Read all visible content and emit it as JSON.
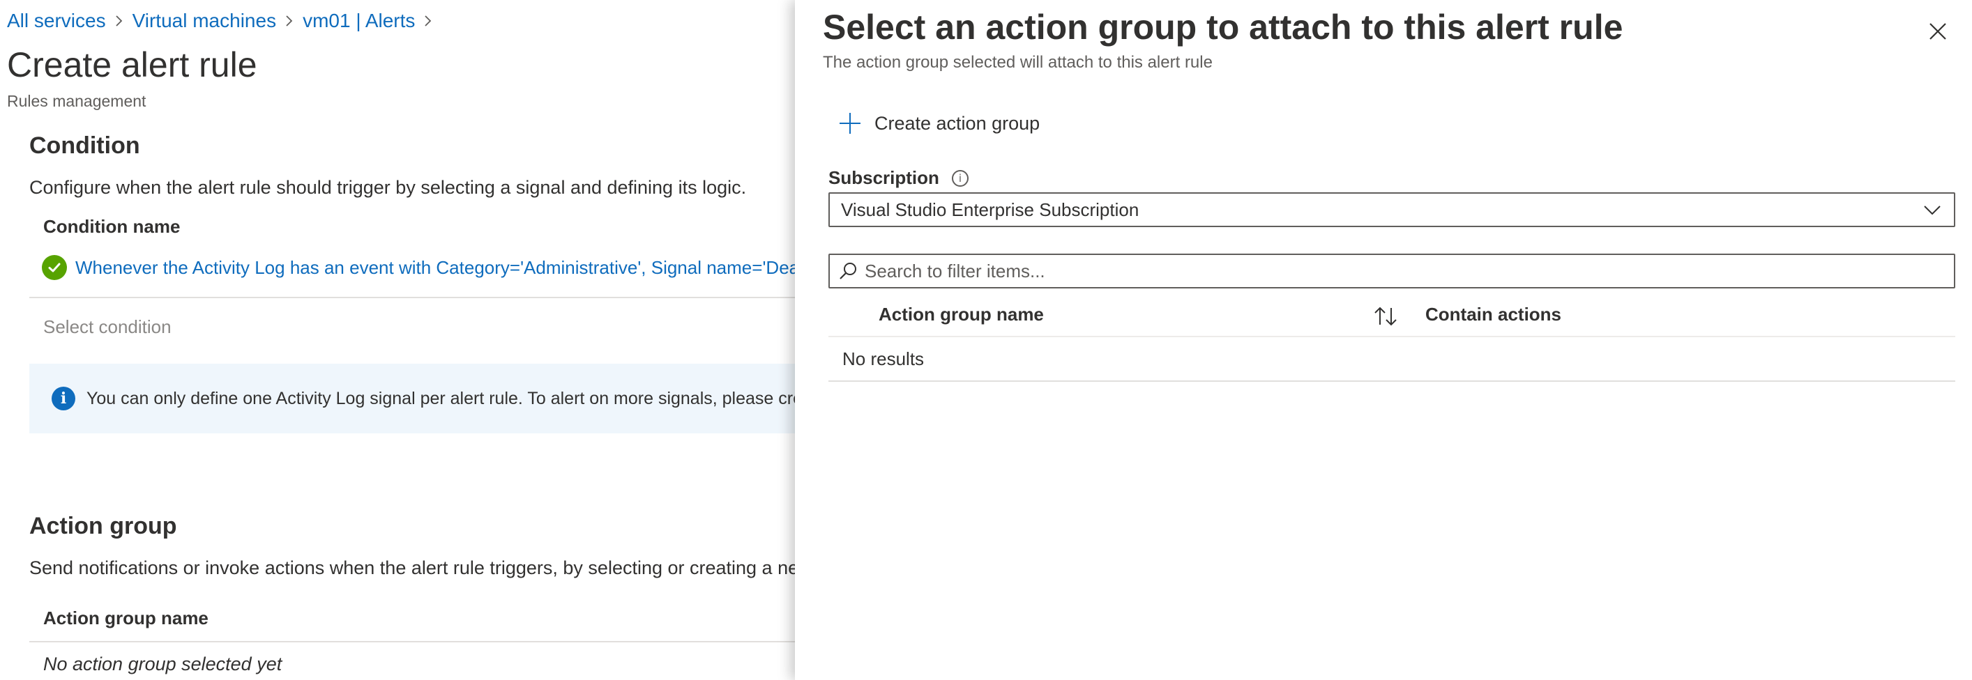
{
  "breadcrumb": {
    "items": [
      "All services",
      "Virtual machines",
      "vm01 | Alerts"
    ]
  },
  "page": {
    "title": "Create alert rule",
    "subtitle": "Rules management"
  },
  "condition": {
    "title": "Condition",
    "description": "Configure when the alert rule should trigger by selecting a signal and defining its logic.",
    "column_header": "Condition name",
    "condition_link": "Whenever the Activity Log has an event with Category='Administrative', Signal name='Dea",
    "select_condition": "Select condition",
    "info_text": "You can only define one Activity Log signal per alert rule. To alert on more signals, please create"
  },
  "action_group": {
    "title": "Action group",
    "description": "Send notifications or invoke actions when the alert rule triggers, by selecting or creating a new a",
    "column_header": "Action group name",
    "empty_text": "No action group selected yet"
  },
  "pane": {
    "title": "Select an action group to attach to this alert rule",
    "subtitle": "The action group selected will attach to this alert rule",
    "create_label": "Create action group",
    "subscription_label": "Subscription",
    "subscription_value": "Visual Studio Enterprise Subscription",
    "search_placeholder": "Search to filter items...",
    "columns": {
      "name": "Action group name",
      "actions": "Contain actions"
    },
    "empty_text": "No results"
  },
  "colors": {
    "link": "#0f6cbd",
    "success": "#57a300",
    "info_bg": "#eff6fc",
    "text": "#323130"
  },
  "icons": [
    "chevron-right-icon",
    "check-circle-icon",
    "info-icon",
    "close-icon",
    "plus-icon",
    "info-outline-icon",
    "chevron-down-icon",
    "search-icon",
    "sort-icon"
  ]
}
